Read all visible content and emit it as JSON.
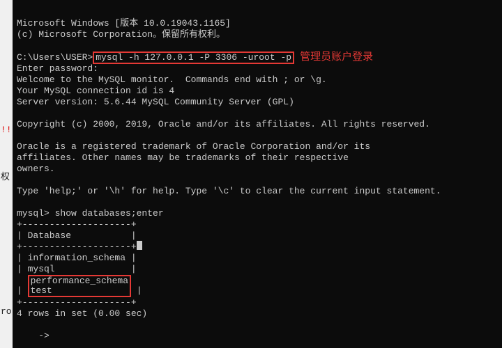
{
  "titlebar": {
    "fragment_icon": "cmd-icon"
  },
  "gutter": {
    "text1": "!!",
    "text2": "权",
    "text3": "ro"
  },
  "terminal": {
    "ms_windows": "Microsoft Windows [版本 10.0.19043.1165]",
    "copyright_ms": "(c) Microsoft Corporation。保留所有权利。",
    "prompt": "C:\\Users\\USER>",
    "login_cmd": "mysql -h 127.0.0.1 -P 3306 -uroot -p",
    "login_annot": "管理员账户登录",
    "enter_password": "Enter password:",
    "welcome": "Welcome to the MySQL monitor.  Commands end with ; or \\g.",
    "conn_id": "Your MySQL connection id is 4",
    "server_version": "Server version: 5.6.44 MySQL Community Server (GPL)",
    "copyright_oracle": "Copyright (c) 2000, 2019, Oracle and/or its affiliates. All rights reserved.",
    "trademark1": "Oracle is a registered trademark of Oracle Corporation and/or its",
    "trademark2": "affiliates. Other names may be trademarks of their respective",
    "trademark3": "owners.",
    "help_line": "Type 'help;' or '\\h' for help. Type '\\c' to clear the current input statement.",
    "mysql_prompt": "mysql> ",
    "show_db_cmd": "show databases;enter",
    "table_top": "+--------------------+",
    "table_header": "| Database           |",
    "table_sep": "+--------------------+",
    "db1": "| information_schema |",
    "db2": "| mysql              |",
    "db3_name": "performance_schema",
    "db4_name": "test              ",
    "table_bot": "+--------------------+",
    "rows_msg": "4 rows in set (0.00 sec)",
    "continuation": "    -> "
  }
}
